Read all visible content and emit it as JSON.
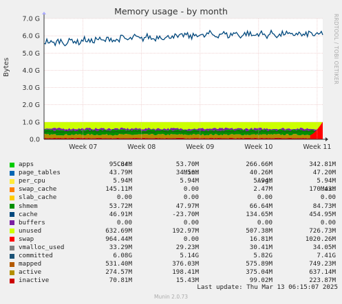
{
  "chart_data": {
    "type": "area",
    "title": "Memory usage - by month",
    "ylabel": "Bytes",
    "side_label": "RRDTOOL / TOBI OETIKER",
    "y_ticks": [
      "0.0",
      "1.0 G",
      "2.0 G",
      "3.0 G",
      "4.0 G",
      "5.0 G",
      "6.0 G",
      "7.0 G"
    ],
    "ylim": [
      0,
      7.0
    ],
    "x_ticks": [
      "Week 07",
      "Week 08",
      "Week 09",
      "Week 10",
      "Week 11"
    ],
    "grid": true,
    "stacked_levels_gb": {
      "inactive": 0.07,
      "active": 0.27,
      "mapped": 0.53,
      "unused": 1.0
    },
    "committed_start_gb": 5.6,
    "committed_end_gb": 6.08,
    "swap_spike_max_gb": 1.02,
    "columns": [
      "Cur:",
      "Min:",
      "Avg:",
      "Max:"
    ],
    "series": [
      {
        "name": "apps",
        "color": "#00cc00",
        "cur": "95.84M",
        "min": "53.70M",
        "avg": "266.66M",
        "max": "342.81M"
      },
      {
        "name": "page_tables",
        "color": "#0066b3",
        "cur": "43.79M",
        "min": "34.50M",
        "avg": "40.26M",
        "max": "47.20M"
      },
      {
        "name": "per_cpu",
        "color": "#ff8000",
        "cur": "5.94M",
        "min": "5.94M",
        "avg": "5.94M",
        "max": "5.94M"
      },
      {
        "name": "swap_cache",
        "color": "#ffcc00",
        "cur": "145.11M",
        "min": "0.00",
        "avg": "2.47M",
        "max": "170.43M"
      },
      {
        "name": "slab_cache",
        "color": "#330099",
        "cur": "0.00",
        "min": "0.00",
        "avg": "0.00",
        "max": "0.00"
      },
      {
        "name": "shmem",
        "color": "#990099",
        "cur": "53.72M",
        "min": "47.97M",
        "avg": "66.64M",
        "max": "84.73M"
      },
      {
        "name": "cache",
        "color": "#ccff00",
        "cur": "46.91M",
        "min": "-23.70M",
        "avg": "134.65M",
        "max": "454.95M"
      },
      {
        "name": "buffers",
        "color": "#ff0000",
        "cur": "0.00",
        "min": "0.00",
        "avg": "0.00",
        "max": "0.00"
      },
      {
        "name": "unused",
        "color": "#808080",
        "cur": "632.69M",
        "min": "192.97M",
        "avg": "507.38M",
        "max": "726.73M"
      },
      {
        "name": "swap",
        "color": "#008f00",
        "cur": "964.44M",
        "min": "0.00",
        "avg": "16.81M",
        "max": "1020.26M"
      },
      {
        "name": "vmalloc_used",
        "color": "#00487d",
        "cur": "33.29M",
        "min": "29.23M",
        "avg": "30.41M",
        "max": "34.05M"
      },
      {
        "name": "committed",
        "color": "#b35a00",
        "cur": "6.08G",
        "min": "5.14G",
        "avg": "5.82G",
        "max": "7.41G"
      },
      {
        "name": "mapped",
        "color": "#b38f00",
        "cur": "531.40M",
        "min": "376.03M",
        "avg": "575.89M",
        "max": "749.23M"
      },
      {
        "name": "active",
        "color": "#6b006b",
        "cur": "274.57M",
        "min": "198.41M",
        "avg": "375.04M",
        "max": "637.14M"
      },
      {
        "name": "inactive",
        "color": "#8fb300",
        "cur": "70.81M",
        "min": "15.43M",
        "avg": "99.02M",
        "max": "223.87M"
      }
    ]
  },
  "legend_swatch_colors": [
    "#00cc00",
    "#0066b3",
    "#ffeb3b",
    "#ff8000",
    "#ffcc00",
    "#008f00",
    "#00487d",
    "#7b1fa2",
    "#ccff00",
    "#ff0000",
    "#808080",
    "#1a5276",
    "#b35a00",
    "#b38f00",
    "#cc0000"
  ],
  "footer": {
    "last_update": "Last update: Thu Mar 13 06:15:07 2025",
    "munin_version": "Munin 2.0.73"
  }
}
